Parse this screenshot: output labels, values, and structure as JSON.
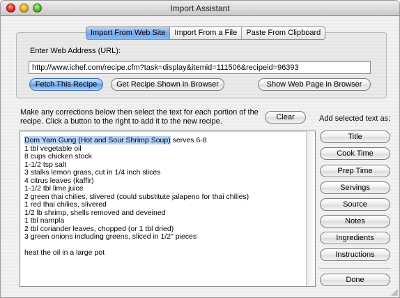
{
  "window": {
    "title": "Import Assistant"
  },
  "source_tabs": [
    {
      "label": "Import From Web Site",
      "active": true
    },
    {
      "label": "Import From a File",
      "active": false
    },
    {
      "label": "Paste From Clipboard",
      "active": false
    }
  ],
  "url": {
    "label": "Enter Web Address (URL):",
    "value": "http://www.ichef.com/recipe.cfm?task=display&itemid=111506&recipeid=96393"
  },
  "web_buttons": {
    "fetch": "Fetch This Recipe",
    "get_shown": "Get Recipe Shown in Browser",
    "show_page": "Show Web Page in Browser"
  },
  "instructions": "Make any corrections below then select the text for each portion of the recipe. Click a button to the right to add it to the new recipe.",
  "clear_button": "Clear",
  "add_label": "Add selected text as:",
  "recipe_text": {
    "selected_title": "Dom Yam Gung (Hot and Sour Shrimp Soup)",
    "title_rest": " serves 6-8",
    "body": "\n1 tbl vegetable oil\n8 cups chicken stock\n1-1/2 tsp salt\n3 stalks lemon grass, cut in 1/4 inch slices\n4 citrus leaves (kaffir)\n1-1/2 tbl lime juice\n2 green thai chilies, slivered (could substitute jalapeno for thai chilies)\n1 red thai chilies, slivered\n1/2 lb shrimp, shells removed and deveined\n1 tbl nampla\n2 tbl coriander leaves, chopped (or 1 tbl dried)\n3 green onions including greens, sliced in 1/2\" pieces\n\nheat the oil in a large pot"
  },
  "add_buttons": {
    "title": "Title",
    "cook_time": "Cook Time",
    "prep_time": "Prep Time",
    "servings": "Servings",
    "source": "Source",
    "notes": "Notes",
    "ingredients": "Ingredients",
    "instructions": "Instructions"
  },
  "done_button": "Done",
  "colors": {
    "selection": "#b5d3f9",
    "default_button": "#5b98e6"
  }
}
